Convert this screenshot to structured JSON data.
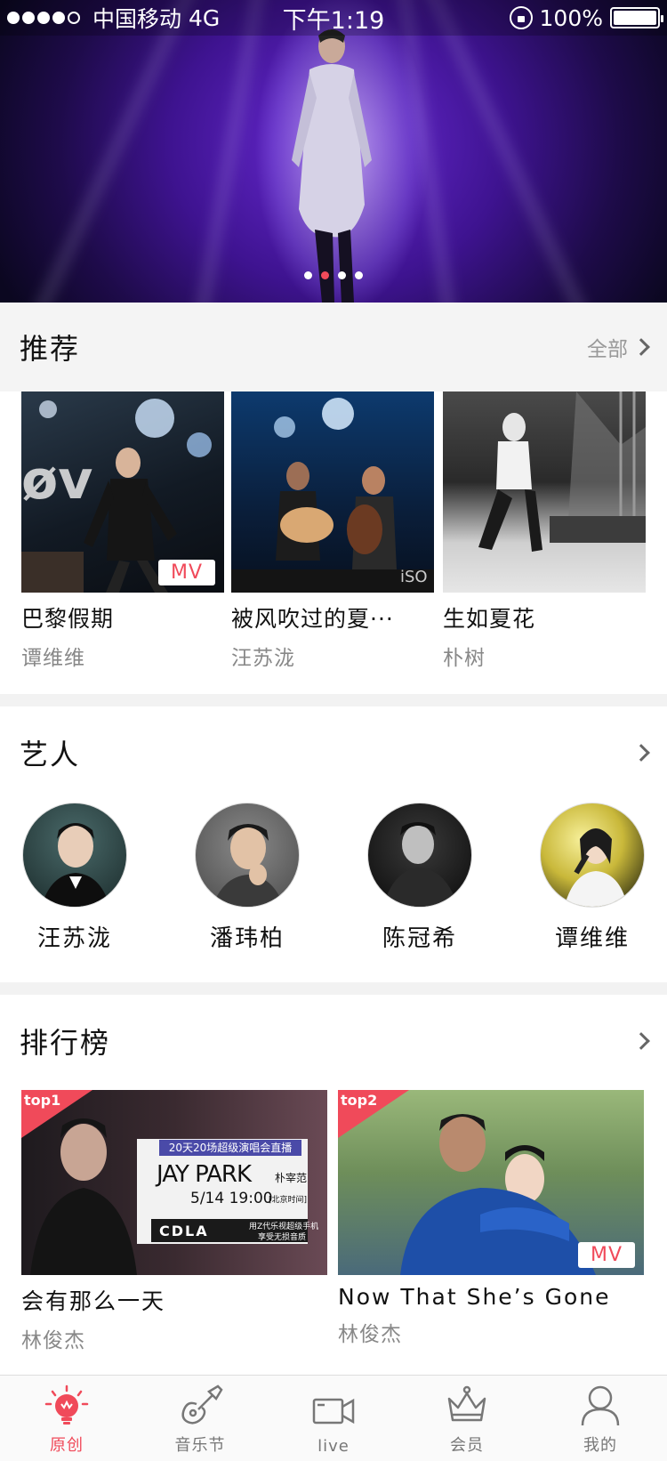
{
  "status_bar": {
    "carrier": "中国移动",
    "network": "4G",
    "time": "下午1:19",
    "battery": "100%",
    "signal_bars": 4
  },
  "banner": {
    "slide_count": 4,
    "active_slide": 2
  },
  "recommend": {
    "title": "推荐",
    "all_label": "全部",
    "items": [
      {
        "title": "巴黎假期",
        "artist": "谭维维",
        "badge": "MV"
      },
      {
        "title": "被风吹过的夏···",
        "artist": "汪苏泷",
        "badge": ""
      },
      {
        "title": "生如夏花",
        "artist": "朴树",
        "badge": ""
      }
    ]
  },
  "artists": {
    "title": "艺人",
    "items": [
      {
        "name": "汪苏泷"
      },
      {
        "name": "潘玮柏"
      },
      {
        "name": "陈冠希"
      },
      {
        "name": "谭维维"
      }
    ]
  },
  "ranking": {
    "title": "排行榜",
    "items": [
      {
        "rank": "top1",
        "title": "会有那么一天",
        "artist": "林俊杰",
        "badge": "",
        "poster": {
          "headline": "20天20场超级演唱会直播",
          "name": "JAY PARK",
          "name_cn": "朴宰范",
          "datetime": "5/14 19:00",
          "tz": "[北京时间]",
          "brand": "CDLA",
          "tag1": "用Z代乐视超级手机",
          "tag2": "享受无损音质"
        }
      },
      {
        "rank": "top2",
        "title": "Now That She’s Gone",
        "artist": "林俊杰",
        "badge": "MV"
      }
    ]
  },
  "tabbar": {
    "items": [
      {
        "label": "原创",
        "active": true,
        "icon": "bulb-icon"
      },
      {
        "label": "音乐节",
        "active": false,
        "icon": "guitar-icon"
      },
      {
        "label": "live",
        "active": false,
        "icon": "video-camera-icon"
      },
      {
        "label": "会员",
        "active": false,
        "icon": "crown-icon"
      },
      {
        "label": "我的",
        "active": false,
        "icon": "user-icon"
      }
    ]
  },
  "colors": {
    "accent": "#f04a5a",
    "muted_text": "#888888",
    "divider": "#f2f2f2"
  }
}
